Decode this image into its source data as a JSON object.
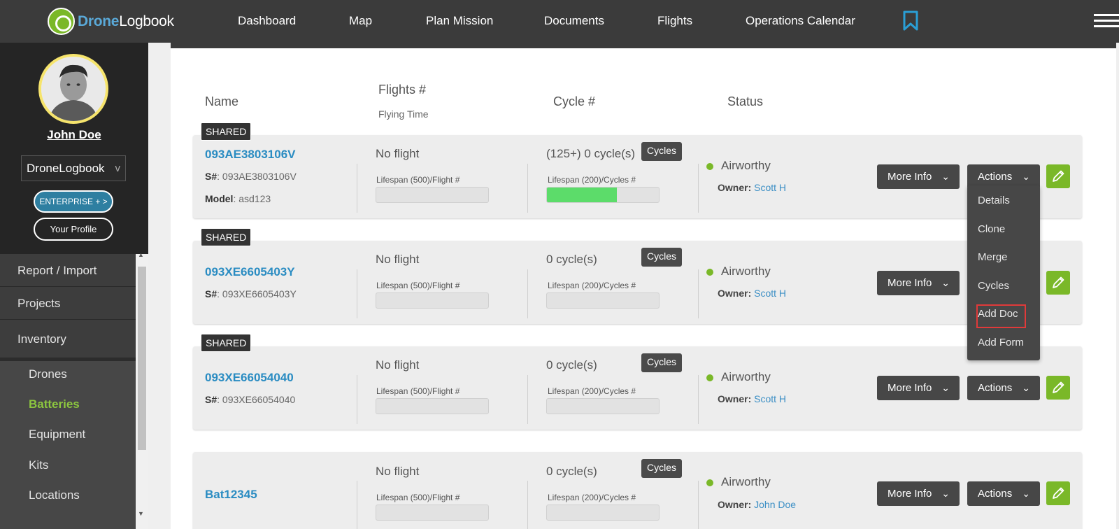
{
  "app": {
    "logo_text_a": "Drone",
    "logo_text_b": "Logbook"
  },
  "nav": {
    "items": [
      "Dashboard",
      "Map",
      "Plan Mission",
      "Documents",
      "Flights",
      "Operations Calendar"
    ],
    "bookmark_icon": "bookmark-icon",
    "menu_icon": "hamburger-icon"
  },
  "profile": {
    "name": "John Doe",
    "org": "DroneLogbook",
    "org_chevron": "v",
    "enterprise_label": "ENTERPRISE + >",
    "profile_label": "Your Profile"
  },
  "sidebar": {
    "items": [
      "Report / Import",
      "Projects",
      "Inventory"
    ],
    "subitems": [
      "Drones",
      "Batteries",
      "Equipment",
      "Kits",
      "Locations"
    ],
    "active_subitem": "Batteries"
  },
  "columns": {
    "name": "Name",
    "flights": "Flights #",
    "flying_time": "Flying Time",
    "cycle": "Cycle #",
    "status": "Status"
  },
  "batteries": [
    {
      "shared": "SHARED",
      "name": "093AE3803106V",
      "serial_label": "S#",
      "serial": ": 093AE3803106V",
      "model_label": "Model",
      "model": ": asd123",
      "flights": "No flight",
      "flight_lifespan": "Lifespan (500)/Flight #",
      "flight_fill": 0,
      "cycles": "(125+) 0 cycle(s)",
      "cycles_btn": "Cycles",
      "cycle_lifespan": "Lifespan (200)/Cycles #",
      "cycle_fill": 0.625,
      "status": "Airworthy",
      "owner_label": "Owner:",
      "owner": "Scott H",
      "more_info": "More Info",
      "actions": "Actions"
    },
    {
      "shared": "SHARED",
      "name": "093XE6605403Y",
      "serial_label": "S#",
      "serial": ": 093XE6605403Y",
      "flights": "No flight",
      "flight_lifespan": "Lifespan (500)/Flight #",
      "flight_fill": 0,
      "cycles": "0 cycle(s)",
      "cycles_btn": "Cycles",
      "cycle_lifespan": "Lifespan (200)/Cycles #",
      "cycle_fill": 0,
      "status": "Airworthy",
      "owner_label": "Owner:",
      "owner": "Scott H",
      "more_info": "More Info"
    },
    {
      "shared": "SHARED",
      "name": "093XE66054040",
      "serial_label": "S#",
      "serial": ": 093XE66054040",
      "flights": "No flight",
      "flight_lifespan": "Lifespan (500)/Flight #",
      "flight_fill": 0,
      "cycles": "0 cycle(s)",
      "cycles_btn": "Cycles",
      "cycle_lifespan": "Lifespan (200)/Cycles #",
      "cycle_fill": 0,
      "status": "Airworthy",
      "owner_label": "Owner:",
      "owner": "Scott H",
      "more_info": "More Info",
      "actions": "Actions"
    },
    {
      "name": "Bat12345",
      "flights": "No flight",
      "flight_lifespan": "Lifespan (500)/Flight #",
      "flight_fill": 0,
      "cycles": "0 cycle(s)",
      "cycles_btn": "Cycles",
      "cycle_lifespan": "Lifespan (200)/Cycles #",
      "cycle_fill": 0,
      "status": "Airworthy",
      "owner_label": "Owner:",
      "owner": "John Doe",
      "more_info": "More Info",
      "actions": "Actions"
    }
  ],
  "actions_menu": {
    "items": [
      "Details",
      "Clone",
      "Merge",
      "Cycles",
      "Add Doc",
      "Add Form"
    ],
    "highlighted": "Add Doc"
  },
  "colors": {
    "accent_blue": "#2a8cc2",
    "accent_green": "#7ab828",
    "topbar": "#3b3b3b"
  }
}
